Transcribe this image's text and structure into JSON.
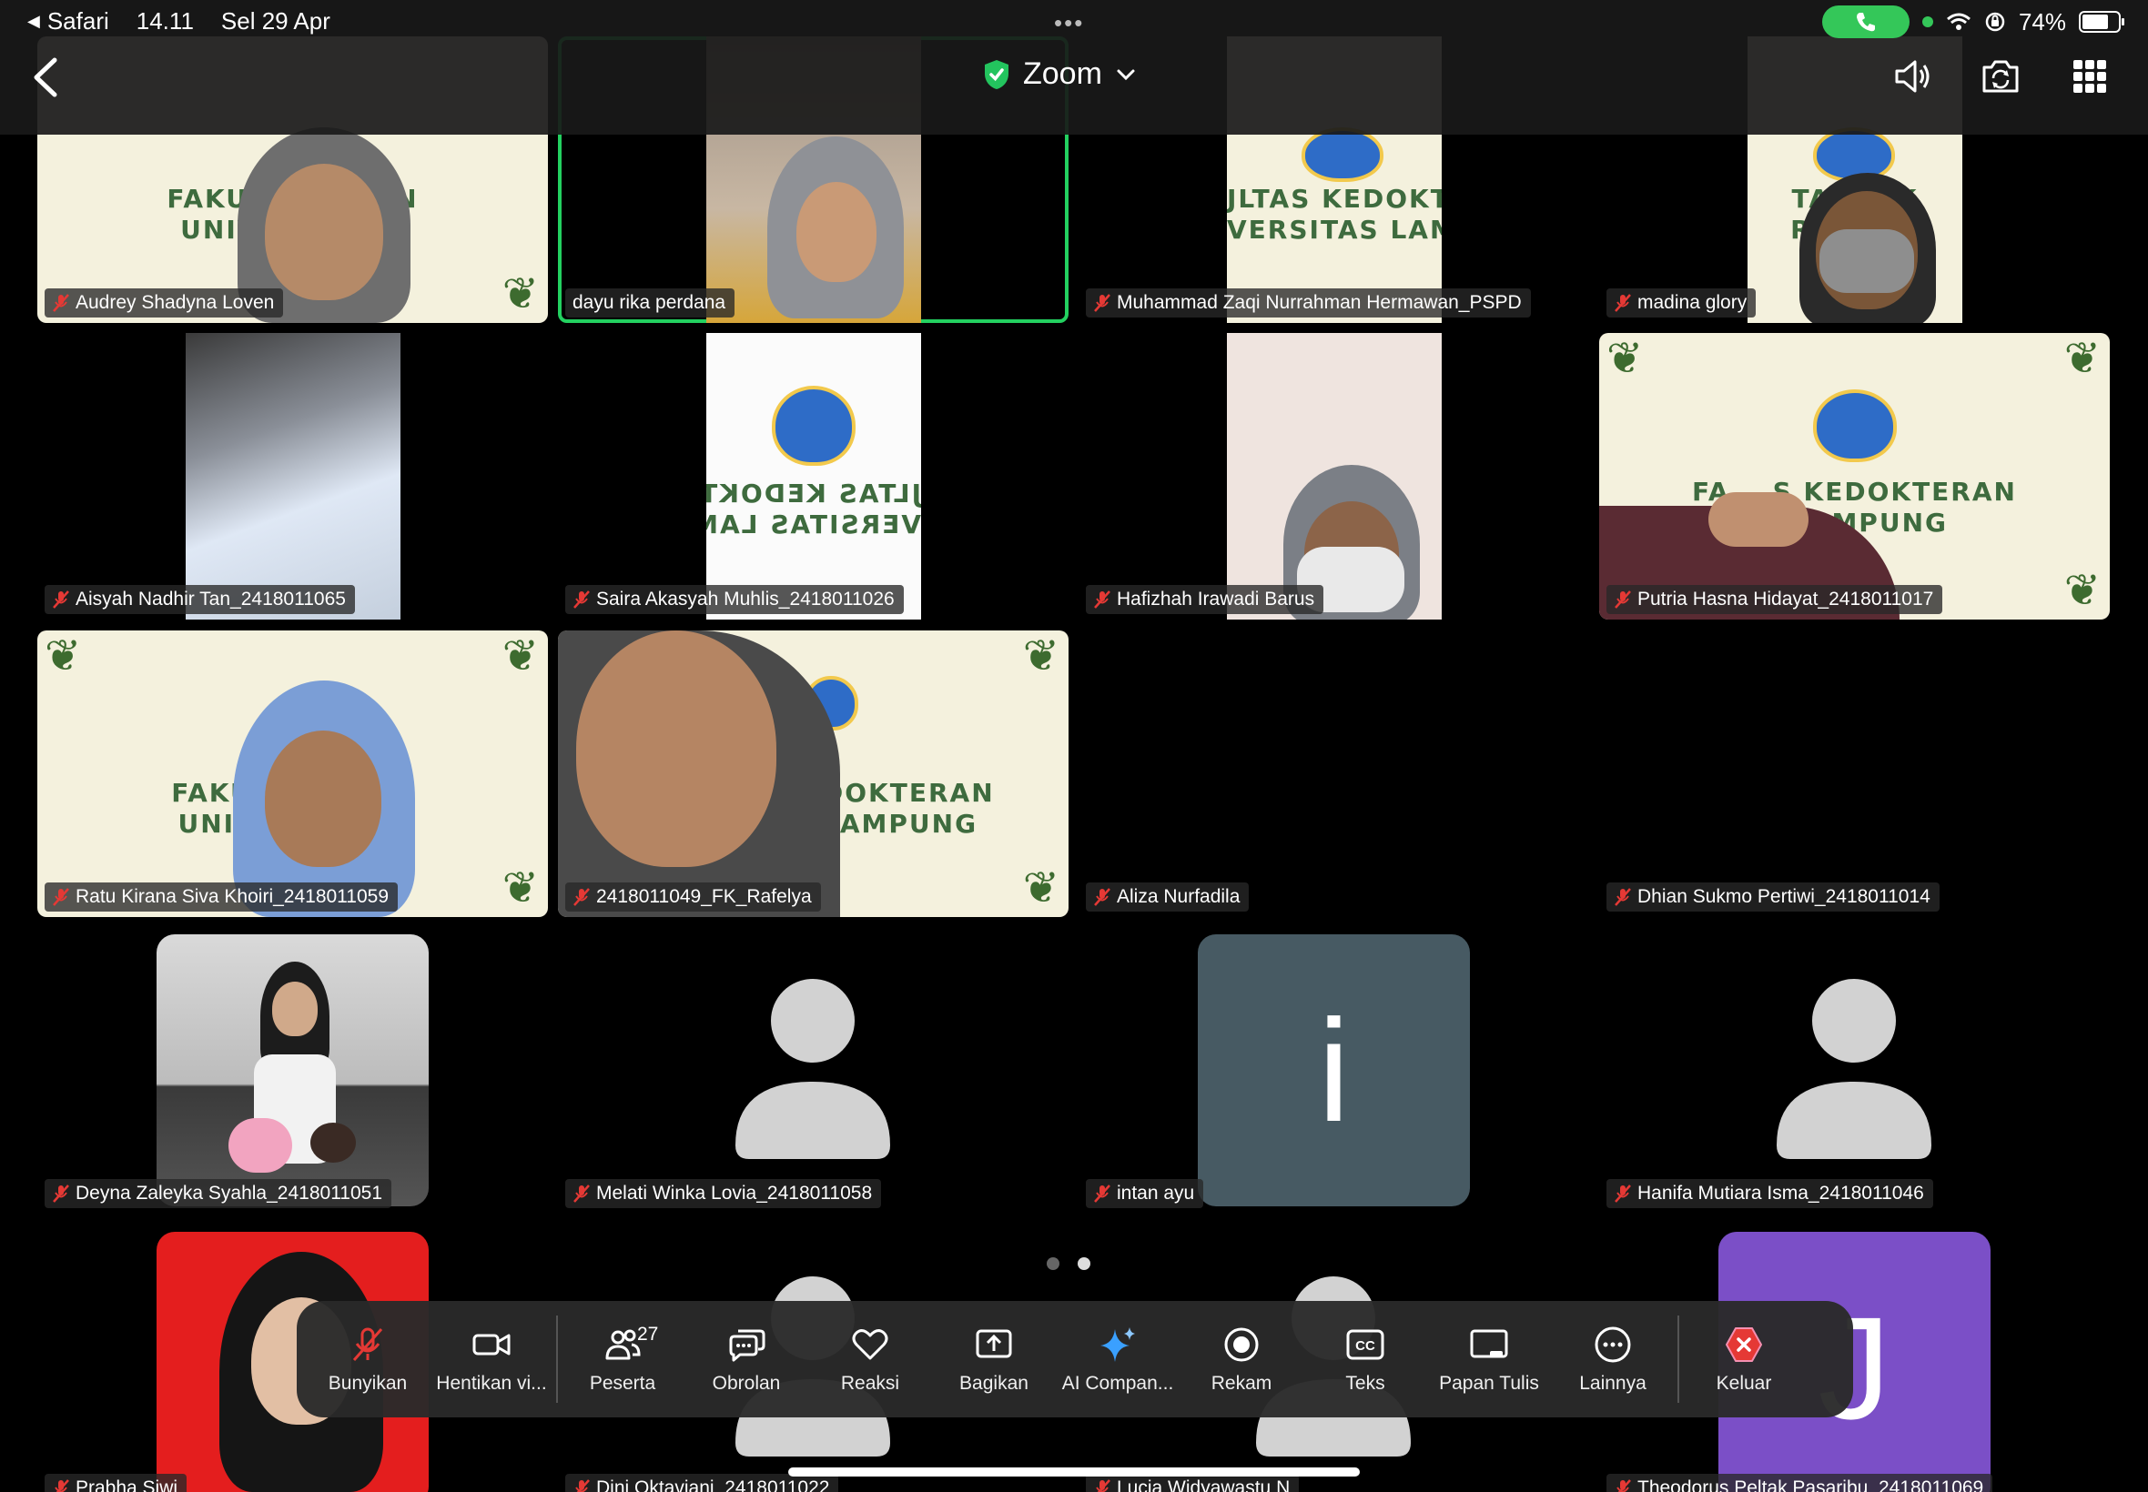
{
  "status_bar": {
    "back_app": "Safari",
    "time": "14.11",
    "date": "Sel 29 Apr",
    "battery": "74%",
    "battery_level": 0.74
  },
  "top_bar": {
    "title": "Zoom"
  },
  "participants": [
    {
      "name": "Audrey Shadyna Loven",
      "muted": true,
      "banner": [
        "FAKULT  KTERAN",
        "UNIVE    MPUNG"
      ]
    },
    {
      "name": "dayu rika perdana",
      "muted": false,
      "active_speaker": true
    },
    {
      "name": "Muhammad Zaqi Nurrahman Hermawan_PSPD",
      "muted": true,
      "banner": [
        "JLTAS KEDOKTE",
        "VERSITAS LAMP"
      ]
    },
    {
      "name": "madina glory",
      "muted": true,
      "banner": [
        "TA    OK",
        "RS    AN"
      ]
    },
    {
      "name": "Aisyah Nadhir Tan_2418011065",
      "muted": true
    },
    {
      "name": "Saira Akasyah Muhlis_2418011026",
      "muted": true,
      "banner": [
        "JLTAS KEDOKTE",
        "VERSITAS LAMP"
      ]
    },
    {
      "name": "Hafizhah Irawadi Barus",
      "muted": true
    },
    {
      "name": "Putria Hasna Hidayat_2418011017",
      "muted": true,
      "banner": [
        "FA    S KEDOKTERAN",
        "S LAMPUNG"
      ]
    },
    {
      "name": "Ratu Kirana Siva Khoiri_2418011059",
      "muted": true,
      "banner": [
        "FAKULT    ERAN",
        "UNIVE    PUNG"
      ]
    },
    {
      "name": "2418011049_FK_Rafelya",
      "muted": true,
      "banner": [
        "DOKTERAN",
        "LAMPUNG"
      ]
    },
    {
      "name": "Aliza Nurfadila",
      "muted": true
    },
    {
      "name": "Dhian Sukmo Pertiwi_2418011014",
      "muted": true
    },
    {
      "name": "Deyna Zaleyka Syahla_2418011051",
      "muted": true
    },
    {
      "name": "Melati Winka Lovia_2418011058",
      "muted": true
    },
    {
      "name": "intan ayu",
      "muted": true,
      "letter": "i"
    },
    {
      "name": "Hanifa Mutiara Isma_2418011046",
      "muted": true
    },
    {
      "name": "Prabha Siwi",
      "muted": true
    },
    {
      "name": "Dini Oktaviani_2418011022",
      "muted": true
    },
    {
      "name": "Lucia Widyawastu N",
      "muted": true
    },
    {
      "name": "Theodorus Peltak Pasaribu_2418011069",
      "muted": true,
      "letter": "J"
    }
  ],
  "pager": {
    "pages": 2,
    "current": 2
  },
  "toolbar": {
    "unmute": "Bunyikan",
    "stop_video": "Hentikan vi...",
    "participants": "Peserta",
    "participants_count": "27",
    "chat": "Obrolan",
    "reactions": "Reaksi",
    "share": "Bagikan",
    "ai_companion": "AI Compan...",
    "record": "Rekam",
    "captions": "Teks",
    "whiteboard": "Papan Tulis",
    "more": "Lainnya",
    "leave": "Keluar"
  },
  "colors": {
    "active_border": "#23d160",
    "leave_red": "#e53935",
    "letter_tile_slate": "#475a63",
    "letter_tile_purple": "#7b4fc7"
  }
}
